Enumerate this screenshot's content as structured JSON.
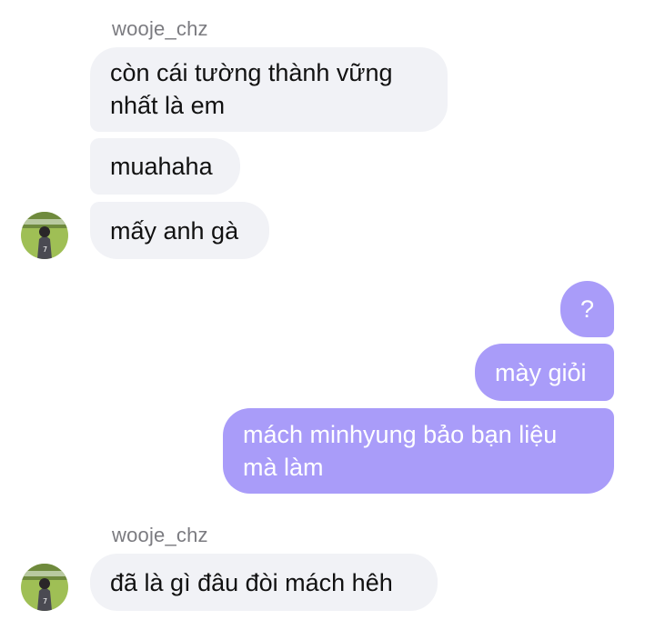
{
  "chat": {
    "group1": {
      "sender": "wooje_chz",
      "messages": [
        {
          "line1": "còn cái tường thành vững",
          "line2": "nhất là em"
        },
        {
          "text": "muahaha"
        },
        {
          "text": "mấy anh gà"
        }
      ]
    },
    "outgoing": [
      {
        "text": "?"
      },
      {
        "text": "mày giỏi"
      },
      {
        "line1": "mách minhyung bảo bạn liệu",
        "line2": "mà làm"
      }
    ],
    "group2": {
      "sender": "wooje_chz",
      "messages": [
        {
          "text": "đã là gì đâu đòi mách hêh"
        }
      ]
    }
  },
  "colors": {
    "incoming_bubble": "#f1f2f6",
    "outgoing_bubble": "#a99cf9",
    "sender_name": "#7b7b80"
  },
  "icons": {
    "avatar": "profile-photo-avatar"
  }
}
